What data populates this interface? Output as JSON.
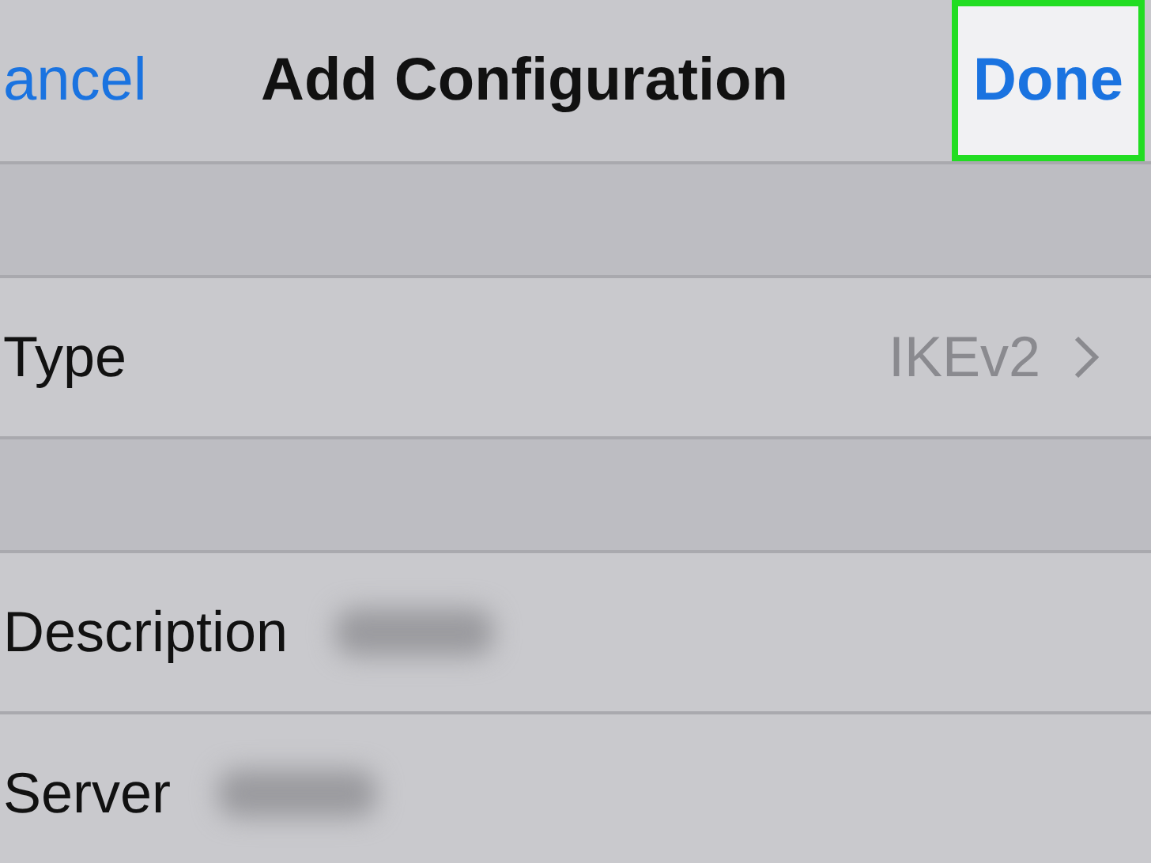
{
  "nav_bar": {
    "cancel": "ancel",
    "title": "Add Configuration",
    "done": {
      "label": "Done",
      "highlighted": true
    }
  },
  "rows": [
    {
      "kind": "value",
      "label": "Type",
      "value": "IKEv2"
    },
    {
      "kind": "gap"
    },
    {
      "kind": "blurred",
      "label": "Description"
    },
    {
      "kind": "blurred",
      "label": "Server"
    }
  ]
}
